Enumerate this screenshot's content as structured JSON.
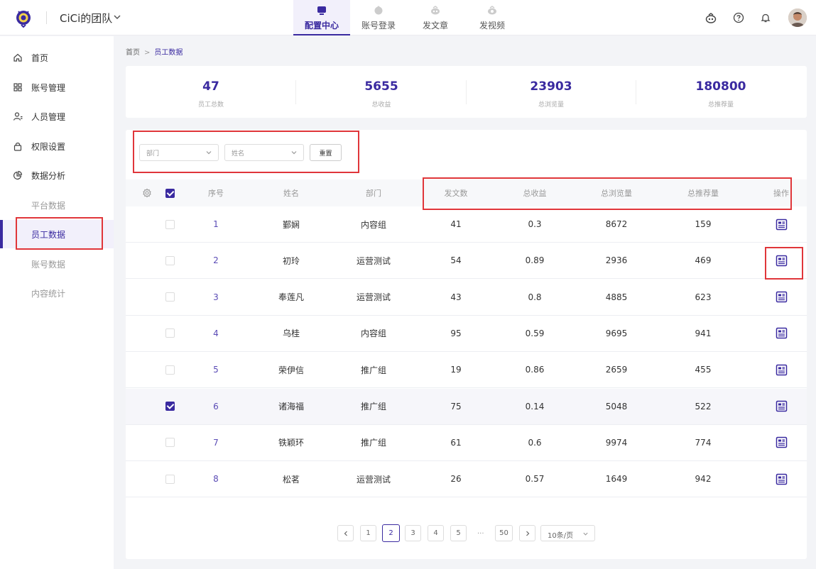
{
  "header": {
    "team_name": "CiCi的团队",
    "nav": [
      {
        "label": "配置中心",
        "icon": "tv-icon",
        "active": true
      },
      {
        "label": "账号登录",
        "icon": "robot-icon",
        "active": false
      },
      {
        "label": "发文章",
        "icon": "bot-head-icon",
        "active": false
      },
      {
        "label": "发视频",
        "icon": "bot-video-icon",
        "active": false
      }
    ],
    "right_icons": [
      "robot-icon",
      "help-icon",
      "bell-icon",
      "avatar"
    ]
  },
  "sidebar": {
    "items": [
      {
        "label": "首页",
        "icon": "home-icon"
      },
      {
        "label": "账号管理",
        "icon": "grid-icon"
      },
      {
        "label": "人员管理",
        "icon": "user-icon"
      },
      {
        "label": "权限设置",
        "icon": "lock-icon"
      },
      {
        "label": "数据分析",
        "icon": "pie-chart-icon"
      }
    ],
    "subitems": [
      {
        "label": "平台数据",
        "active": false
      },
      {
        "label": "员工数据",
        "active": true
      },
      {
        "label": "账号数据",
        "active": false
      },
      {
        "label": "内容统计",
        "active": false
      }
    ]
  },
  "breadcrumb": {
    "home": "首页",
    "sep": ">",
    "current": "员工数据"
  },
  "stats": [
    {
      "value": "47",
      "label": "员工总数"
    },
    {
      "value": "5655",
      "label": "总收益"
    },
    {
      "value": "23903",
      "label": "总浏览量"
    },
    {
      "value": "180800",
      "label": "总推荐量"
    }
  ],
  "filters": {
    "department_placeholder": "部门",
    "name_placeholder": "姓名",
    "reset_label": "重置"
  },
  "table": {
    "headers": [
      "序号",
      "姓名",
      "部门",
      "发文数",
      "总收益",
      "总浏览量",
      "总推荐量",
      "操作"
    ],
    "rows": [
      {
        "idx": "1",
        "name": "鄞娴",
        "dept": "内容组",
        "posts": "41",
        "income": "0.3",
        "views": "8672",
        "recs": "159",
        "checked": false
      },
      {
        "idx": "2",
        "name": "初玲",
        "dept": "运营测试",
        "posts": "54",
        "income": "0.89",
        "views": "2936",
        "recs": "469",
        "checked": false
      },
      {
        "idx": "3",
        "name": "奉莲凡",
        "dept": "运营测试",
        "posts": "43",
        "income": "0.8",
        "views": "4885",
        "recs": "623",
        "checked": false
      },
      {
        "idx": "4",
        "name": "乌桂",
        "dept": "内容组",
        "posts": "95",
        "income": "0.59",
        "views": "9695",
        "recs": "941",
        "checked": false
      },
      {
        "idx": "5",
        "name": "荣伊信",
        "dept": "推广组",
        "posts": "19",
        "income": "0.86",
        "views": "2659",
        "recs": "455",
        "checked": false
      },
      {
        "idx": "6",
        "name": "诸海福",
        "dept": "推广组",
        "posts": "75",
        "income": "0.14",
        "views": "5048",
        "recs": "522",
        "checked": true
      },
      {
        "idx": "7",
        "name": "铁颖环",
        "dept": "推广组",
        "posts": "61",
        "income": "0.6",
        "views": "9974",
        "recs": "774",
        "checked": false
      },
      {
        "idx": "8",
        "name": "松茗",
        "dept": "运营测试",
        "posts": "26",
        "income": "0.57",
        "views": "1649",
        "recs": "942",
        "checked": false
      }
    ]
  },
  "pagination": {
    "pages": [
      "1",
      "2",
      "3",
      "4",
      "5"
    ],
    "current": "2",
    "ellipsis": "...",
    "last": "50",
    "page_size": "10条/页"
  },
  "colors": {
    "accent": "#3a2aa0",
    "highlight": "#e0363a"
  }
}
